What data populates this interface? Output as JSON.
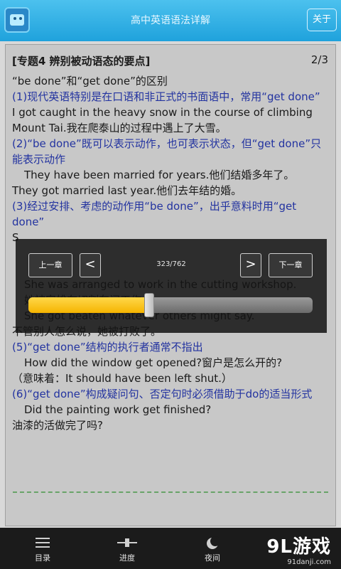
{
  "header": {
    "title": "高中英语语法详解",
    "about_label": "关于"
  },
  "content": {
    "heading": "[专题4 辨别被动语态的要点]",
    "page": "2/3",
    "lines": [
      {
        "text": "“be done”和“get done”的区别",
        "color": "black"
      },
      {
        "text": "(1)现代英语特别是在口语和非正式的书面语中，常用“get done”",
        "color": "blue"
      },
      {
        "text": "I got caught in the heavy snow in the course of climbing",
        "color": "black"
      },
      {
        "text": "Mount Tai.我在爬泰山的过程中遇上了大雪。",
        "color": "black"
      },
      {
        "text": "(2)“be done”既可以表示动作，也可表示状态，但“get done”只",
        "color": "blue"
      },
      {
        "text": "能表示动作",
        "color": "blue"
      },
      {
        "text": "They have been married for years.他们结婚多年了。",
        "color": "black",
        "indent": true
      },
      {
        "text": "They got married last year.他们去年结的婚。",
        "color": "black"
      },
      {
        "text": "(3)经过安排、考虑的动作用“be done”，出乎意料时用“get",
        "color": "blue"
      },
      {
        "text": "done”",
        "color": "blue"
      },
      {
        "text": "S",
        "color": "black"
      },
      {
        "text": "",
        "color": "black"
      },
      {
        "text": "",
        "color": "black"
      },
      {
        "text": "She was arranged to work in the cutting workshop.",
        "color": "black",
        "indent": true
      },
      {
        "text": "她被安排在切割车间工作。",
        "color": "black",
        "indent": true
      },
      {
        "text": "She got beaten whatever others might say.",
        "color": "black",
        "indent": true
      },
      {
        "text": "不管别人怎么说，她被打败了。",
        "color": "black"
      },
      {
        "text": "(5)“get done”结构的执行者通常不指出",
        "color": "blue"
      },
      {
        "text": "How did the window get opened?窗户是怎么开的?",
        "color": "black",
        "indent": true
      },
      {
        "text": "（意味着：It should have been left shut.）",
        "color": "black"
      },
      {
        "text": "(6)“get done”构成疑问句、否定句时必须借助于do的适当形式",
        "color": "blue"
      },
      {
        "text": "Did the painting work get finished?",
        "color": "black",
        "indent": true
      },
      {
        "text": "油漆的活做完了吗?",
        "color": "black"
      }
    ]
  },
  "overlay": {
    "prev_chapter": "上一章",
    "prev": "<",
    "progress_text": "323/762",
    "next": ">",
    "next_chapter": "下一章",
    "progress_fraction": 0.424
  },
  "bottom_nav": [
    {
      "label": "目录",
      "icon": "list-icon"
    },
    {
      "label": "进度",
      "icon": "slider-icon"
    },
    {
      "label": "夜间",
      "icon": "moon-icon"
    }
  ],
  "watermark": {
    "brand": "9L游戏",
    "site": "91danji.com"
  }
}
